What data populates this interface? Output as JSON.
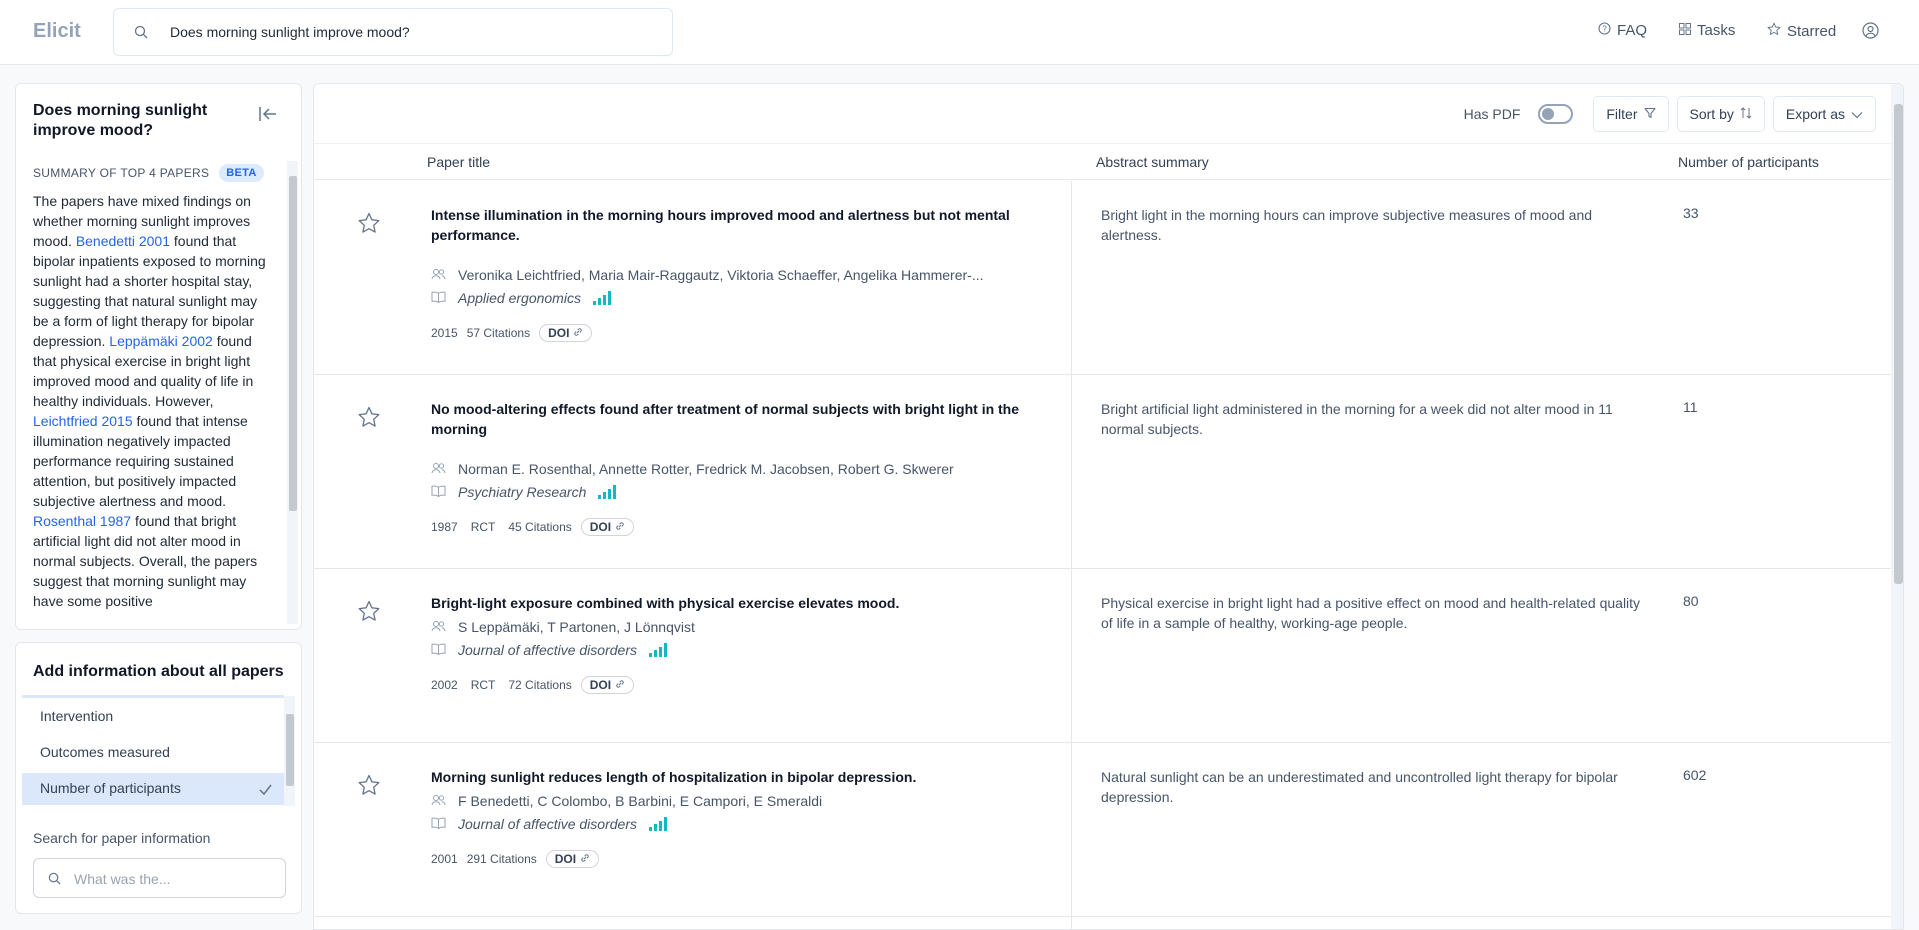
{
  "app": {
    "name": "Elicit"
  },
  "search": {
    "query": "Does morning sunlight improve mood?"
  },
  "nav": {
    "faq": "FAQ",
    "tasks": "Tasks",
    "starred": "Starred"
  },
  "sidebar": {
    "question": "Does morning sunlight improve mood?",
    "summary_header": "SUMMARY OF TOP 4 PAPERS",
    "beta": "BETA",
    "summary": {
      "intro": "The papers have mixed findings on whether morning sunlight improves mood. ",
      "cite1": "Benedetti 2001",
      "text1": " found that bipolar inpatients exposed to morning sunlight had a shorter hospital stay, suggesting that natural sunlight may be a form of light therapy for bipolar depression. ",
      "cite2": "Leppämäki 2002",
      "text2": " found that physical exercise in bright light improved mood and quality of life in healthy individuals. However, ",
      "cite3": "Leichtfried 2015",
      "text3": " found that intense illumination negatively impacted performance requiring sustained attention, but positively impacted subjective alertness and mood. ",
      "cite4": "Rosenthal 1987",
      "text4": " found that bright artificial light did not alter mood in normal subjects. Overall, the papers suggest that morning sunlight may have some positive"
    }
  },
  "add_info": {
    "title": "Add information about all papers",
    "options": [
      "Intervention",
      "Outcomes measured",
      "Number of participants"
    ],
    "selected": "Number of participants",
    "search_label": "Search for paper information",
    "search_placeholder": "What was the..."
  },
  "toolbar": {
    "has_pdf": "Has PDF",
    "filter": "Filter",
    "sort": "Sort by",
    "export": "Export as"
  },
  "table": {
    "headers": {
      "title": "Paper title",
      "abstract": "Abstract summary",
      "participants": "Number of participants"
    },
    "rows": [
      {
        "title": "Intense illumination in the morning hours improved mood and alertness but not mental performance.",
        "authors": "Veronika Leichtfried, Maria Mair-Raggautz, Viktoria Schaeffer, Angelika Hammerer-...",
        "journal": "Applied ergonomics",
        "year": "2015",
        "type": "",
        "citations": "57 Citations",
        "doi": "DOI",
        "abstract": "Bright light in the morning hours can improve subjective measures of mood and alertness.",
        "participants": "33"
      },
      {
        "title": "No mood-altering effects found after treatment of normal subjects with bright light in the morning",
        "authors": "Norman E. Rosenthal, Annette Rotter, Fredrick M. Jacobsen, Robert G. Skwerer",
        "journal": "Psychiatry Research",
        "year": "1987",
        "type": "RCT",
        "citations": "45 Citations",
        "doi": "DOI",
        "abstract": "Bright artificial light administered in the morning for a week did not alter mood in 11 normal subjects.",
        "participants": "11"
      },
      {
        "title": "Bright-light exposure combined with physical exercise elevates mood.",
        "authors": "S Leppämäki, T Partonen, J Lönnqvist",
        "journal": "Journal of affective disorders",
        "year": "2002",
        "type": "RCT",
        "citations": "72 Citations",
        "doi": "DOI",
        "abstract": "Physical exercise in bright light had a positive effect on mood and health-related quality of life in a sample of healthy, working-age people.",
        "participants": "80"
      },
      {
        "title": "Morning sunlight reduces length of hospitalization in bipolar depression.",
        "authors": "F Benedetti, C Colombo, B Barbini, E Campori, E Smeraldi",
        "journal": "Journal of affective disorders",
        "year": "2001",
        "type": "",
        "citations": "291 Citations",
        "doi": "DOI",
        "abstract": "Natural sunlight can be an underestimated and uncontrolled light therapy for bipolar depression.",
        "participants": "602"
      }
    ]
  }
}
